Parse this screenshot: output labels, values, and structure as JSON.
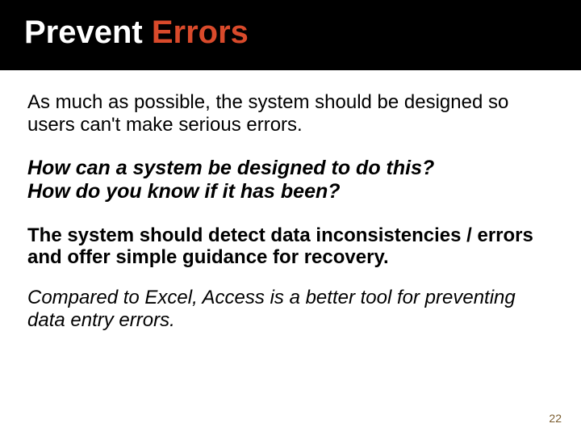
{
  "title": {
    "word1": "Prevent ",
    "word2": "Errors"
  },
  "body": {
    "intro": "As much as possible, the system should be designed so users can't make serious errors.",
    "q1": "How can a system be designed to do this?",
    "q2": "How do you know if it has been?",
    "detect": "The system should detect data inconsistencies / errors and offer simple guidance for recovery.",
    "compare": "Compared to Excel, Access is a better tool for preventing data entry errors."
  },
  "page_number": "22"
}
